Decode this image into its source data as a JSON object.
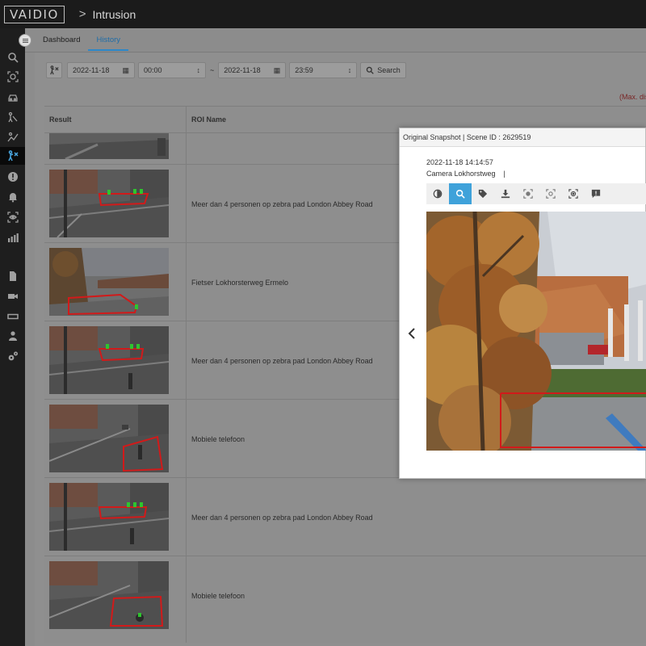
{
  "header": {
    "logo": "VAIDIO",
    "breadcrumb_separator": ">",
    "page_title": "Intrusion"
  },
  "sidebar": {
    "items": [
      {
        "icon": "search-icon"
      },
      {
        "icon": "face-scan-icon"
      },
      {
        "icon": "car-icon"
      },
      {
        "icon": "person-route-icon"
      },
      {
        "icon": "traffic-analytics-icon"
      },
      {
        "icon": "intrusion-icon",
        "active": true
      },
      {
        "icon": "alert-icon"
      },
      {
        "icon": "bell-icon"
      },
      {
        "icon": "eye-icon"
      },
      {
        "icon": "report-chart-icon"
      },
      {
        "icon": "document-icon"
      },
      {
        "icon": "video-camera-icon"
      },
      {
        "icon": "nvr-icon"
      },
      {
        "icon": "users-icon"
      },
      {
        "icon": "settings-icon"
      }
    ]
  },
  "tabs": [
    {
      "label": "Dashboard"
    },
    {
      "label": "History",
      "active": true
    }
  ],
  "filters": {
    "start_date": "2022-11-18",
    "start_time": "00:00",
    "separator": "~",
    "end_date": "2022-11-18",
    "end_time": "23:59",
    "search_label": "Search"
  },
  "max_note": "(Max. displ",
  "table": {
    "columns": [
      "Result",
      "ROI Name"
    ],
    "rows": [
      {
        "roi": ""
      },
      {
        "roi": "Meer dan 4 personen op zebra pad London Abbey Road"
      },
      {
        "roi": "Fietser Lokhorsterweg Ermelo"
      },
      {
        "roi": "Meer dan 4 personen op zebra pad London Abbey Road"
      },
      {
        "roi": "Mobiele telefoon"
      },
      {
        "roi": "Meer dan 4 personen op zebra pad London Abbey Road"
      },
      {
        "roi": "Mobiele telefoon"
      }
    ]
  },
  "modal": {
    "title": "Original Snapshot | Scene ID : 2629519",
    "timestamp": "2022-11-18 14:14:57",
    "camera": "Camera Lokhorstweg    |",
    "toolbar": [
      {
        "icon": "contrast-icon"
      },
      {
        "icon": "zoom-icon",
        "active": true
      },
      {
        "icon": "tag-icon"
      },
      {
        "icon": "download-icon"
      },
      {
        "icon": "face-frame-icon"
      },
      {
        "icon": "face-frame-alt-icon"
      },
      {
        "icon": "face-target-icon"
      },
      {
        "icon": "report-issue-icon"
      }
    ]
  },
  "colors": {
    "accent": "#2c87c8",
    "roi_outline": "#d11a1a",
    "max_note": "#7a2626"
  }
}
